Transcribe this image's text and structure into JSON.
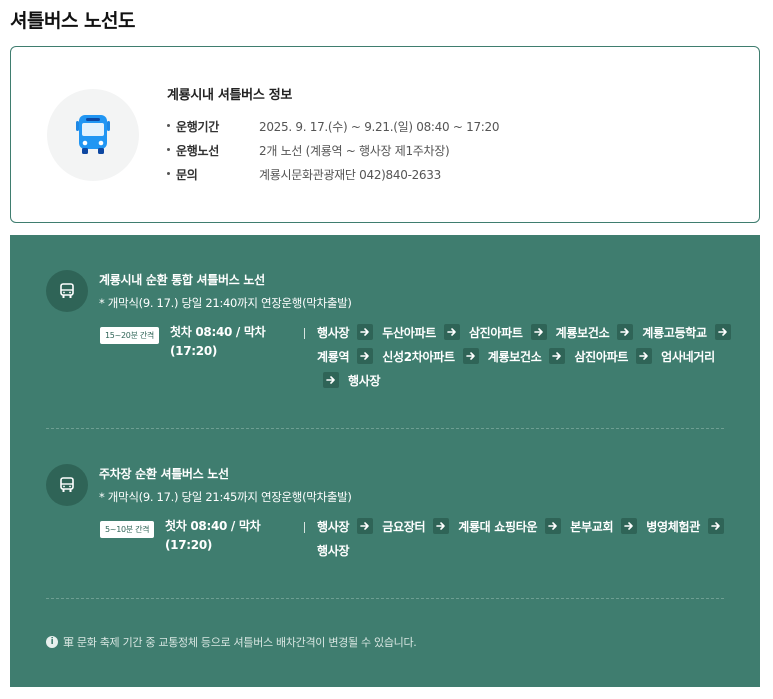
{
  "page": {
    "title": "셔틀버스 노선도"
  },
  "info": {
    "title": "계룡시내 셔틀버스 정보",
    "rows": [
      {
        "label": "운행기간",
        "value": "2025. 9. 17.(수) ~ 9.21.(일) 08:40 ~ 17:20"
      },
      {
        "label": "운행노선",
        "value": "2개 노선 (계룡역 ~ 행사장 제1주차장)"
      },
      {
        "label": "문의",
        "value": "계룡시문화관광재단 042)840-2633"
      }
    ],
    "icon": "bus-icon",
    "accent": "#1e88e5"
  },
  "routes": [
    {
      "name": "계룡시내 순환 통합 셔틀버스 노선",
      "note": "* 개막식(9. 17.) 당일 21:40까지 연장운행(막차출발)",
      "interval": "15~20분 간격",
      "time_line1": "첫차 08:40 / 막차",
      "time_line2": "(17:20)",
      "stops": [
        "행사장",
        "두산아파트",
        "삼진아파트",
        "계룡보건소",
        "계룡고등학교",
        "계룡역",
        "신성2차아파트",
        "계룡보건소",
        "삼진아파트",
        "엄사네거리",
        "행사장"
      ]
    },
    {
      "name": "주차장 순환 셔틀버스 노선",
      "note": "* 개막식(9. 17.) 당일 21:45까지 연장운행(막차출발)",
      "interval": "5~10분 간격",
      "time_line1": "첫차 08:40 / 막차",
      "time_line2": "(17:20)",
      "stops": [
        "행사장",
        "금요장터",
        "계룡대 쇼핑타운",
        "본부교회",
        "병영체험관",
        "행사장"
      ]
    }
  ],
  "footer": {
    "text": "軍 문화 축제 기간 중 교통정체 등으로 셔틀버스 배차간격이 변경될 수 있습니다."
  },
  "colors": {
    "panel": "#3f7d6f",
    "panel_dark": "#2f6457",
    "border": "#3f7d6f"
  }
}
